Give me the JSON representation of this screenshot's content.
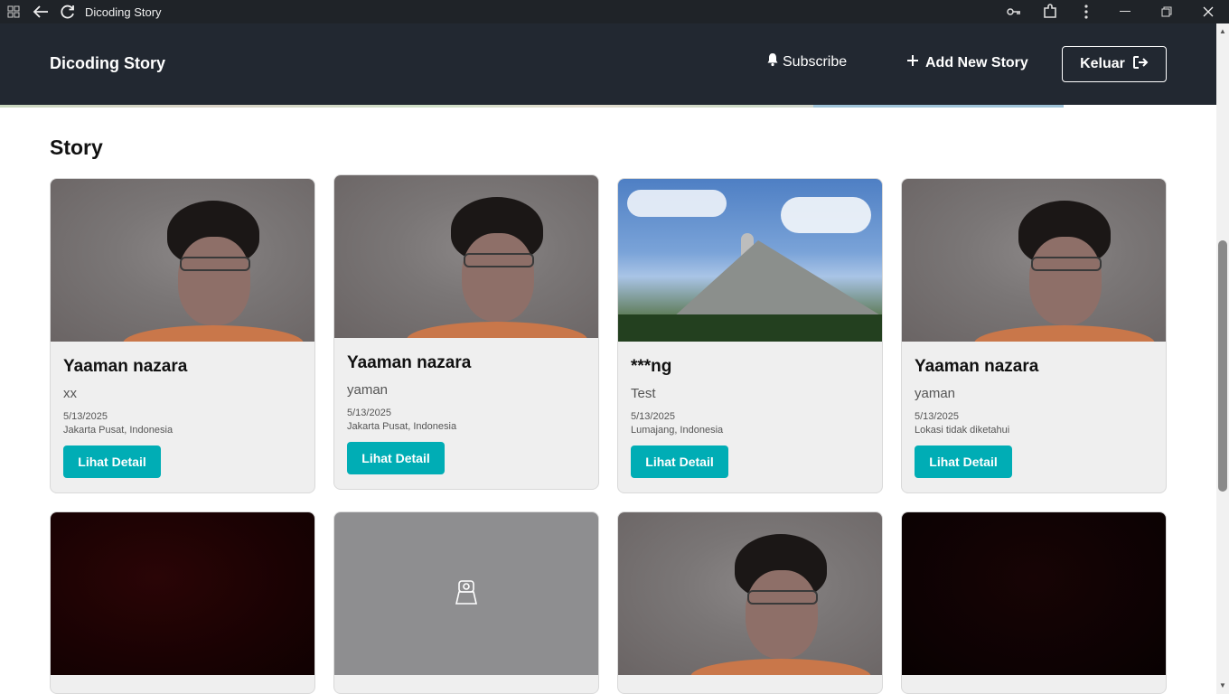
{
  "window": {
    "title": "Dicoding Story",
    "icons": [
      "grid-icon",
      "back-arrow-icon",
      "reload-icon",
      "key-icon",
      "extension-icon",
      "more-icon",
      "minimize-icon",
      "restore-icon",
      "close-icon"
    ]
  },
  "header": {
    "brand": "Dicoding Story",
    "subscribe_label": "Subscribe",
    "add_story_label": "Add New Story",
    "logout_label": "Keluar"
  },
  "main": {
    "section_title": "Story",
    "detail_label": "Lihat Detail",
    "stories": [
      {
        "name": "Yaaman nazara",
        "description": "xx",
        "date": "5/13/2025",
        "location": "Jakarta Pusat, Indonesia",
        "image": "person"
      },
      {
        "name": "Yaaman nazara",
        "description": "yaman",
        "date": "5/13/2025",
        "location": "Jakarta Pusat, Indonesia",
        "image": "person"
      },
      {
        "name": "***ng",
        "description": "Test",
        "date": "5/13/2025",
        "location": "Lumajang, Indonesia",
        "image": "mountain"
      },
      {
        "name": "Yaaman nazara",
        "description": "yaman",
        "date": "5/13/2025",
        "location": "Lokasi tidak diketahui",
        "image": "person"
      },
      {
        "image": "dark"
      },
      {
        "image": "camera-placeholder"
      },
      {
        "image": "person"
      },
      {
        "image": "black"
      }
    ]
  },
  "colors": {
    "header_bg": "#222831",
    "accent": "#00adb5",
    "card_bg": "#efefef"
  }
}
